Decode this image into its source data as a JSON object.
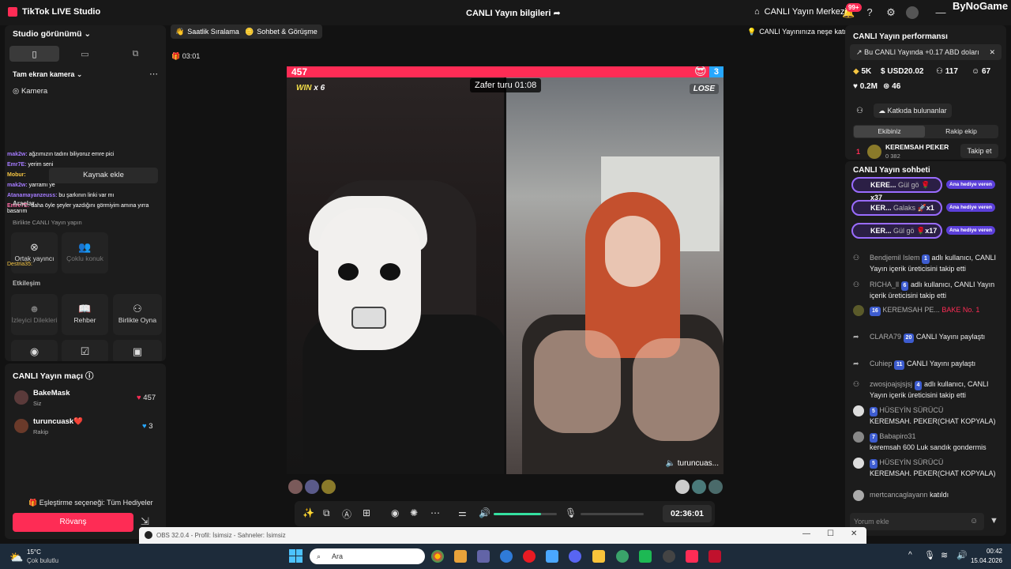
{
  "titlebar": {
    "app_name": "TikTok LIVE Studio",
    "center_title": "CANLI Yayın bilgileri",
    "live_center": "CANLI Yayın Merkezi",
    "notif_badge": "99+",
    "watermark": "ByNoGame"
  },
  "left": {
    "studio_view": "Studio görünümü",
    "fullscreen_camera": "Tam ekran kamera",
    "camera": "Kamera",
    "add_source": "Kaynak ekle",
    "tools_label": "Araçlar",
    "collab_title": "Birlikte CANLI Yayın yapın",
    "co_host": "Ortak yayıncı",
    "multi_guest": "Çoklu konuk",
    "interaction": "Etkileşim",
    "viewer_wishes": "İzleyici Dilekleri",
    "guide": "Rehber",
    "play_together": "Birlikte Oyna",
    "overlay_chat": [
      {
        "user": "mak2w:",
        "text": "ağzımızın tadını biliyoruz emre pici"
      },
      {
        "user": "Emr7E:",
        "text": "yerim seni"
      },
      {
        "user": "Mobur:",
        "text": ""
      },
      {
        "user": "mak2w:",
        "text": "yarramı ye"
      },
      {
        "user": "Atanamayanzeuss:",
        "text": "bu şarkının linki var mı"
      },
      {
        "user": "Emre7E:",
        "text": "daha öyle şeyler yazdığını görmiyim amına yırra basarım"
      },
      {
        "user": "Destria35:",
        "text": ""
      }
    ]
  },
  "match": {
    "title": "CANLI Yayın maçı",
    "players": [
      {
        "name": "BakeMask",
        "role": "Siz",
        "score": "457"
      },
      {
        "name": "turuncuask❤️",
        "role": "Rakip",
        "score": "3"
      }
    ],
    "pairing_option": "Eşleştirme seçeneği: Tüm Hediyeler",
    "rematch": "Rövanş"
  },
  "center": {
    "chips": [
      "Saatlik Sıralama",
      "Sohbet & Görüşme"
    ],
    "right_chip": "CANLI Yayınınıza neşe katın",
    "elapsed_small": "03:01",
    "score_left": "457",
    "score_right": "3",
    "win_label": "WIN",
    "win_count": "x 6",
    "lose_label": "LOSE",
    "round_timer": "Zafer turu 01:08",
    "right_name": "turuncuas...",
    "stream_time": "02:36:01"
  },
  "perf": {
    "title": "CANLI Yayın performansı",
    "banner": "Bu CANLI Yayında +0.17 ABD doları",
    "stats": [
      "5K",
      "USD20.02",
      "117",
      "67",
      "0.2M",
      "46"
    ],
    "contributors": "Katkıda bulunanlar",
    "tab_ours": "Ekibiniz",
    "tab_rival": "Rakip ekip",
    "rank1_num": "1",
    "rank1_name": "KEREMSAH PEKER",
    "rank1_sub": "0  382",
    "follow": "Takip et"
  },
  "chat": {
    "title": "CANLI Yayın sohbeti",
    "gifts": [
      {
        "user": "KERE...",
        "gift": "Gül gö",
        "count": "x37",
        "tag": "Ana hediye veren"
      },
      {
        "user": "KER...",
        "gift": "Galaks",
        "count": "x1",
        "tag": "Ana hediye veren"
      },
      {
        "user": "KER...",
        "gift": "Gül gö",
        "count": "x17",
        "tag": "Ana hediye veren"
      }
    ],
    "messages": [
      {
        "user": "Bendjemil Islem",
        "lvl": "1",
        "text": "adlı kullanıcı, CANLI Yayın içerik üreticisini takip etti"
      },
      {
        "user": "RICHA_ll",
        "lvl": "6",
        "text": "adlı kullanıcı, CANLI Yayın içerik üreticisini takip etti"
      },
      {
        "user": "KEREMSAH PE...",
        "lvl": "16",
        "text": "BAKE  No. 1"
      },
      {
        "user": "CLARA79",
        "lvl": "20",
        "text": "CANLI Yayını paylaştı"
      },
      {
        "user": "Cuhiep",
        "lvl": "11",
        "text": "CANLI Yayını paylaştı"
      },
      {
        "user": "zwosjoajsjsjsj",
        "lvl": "4",
        "text": "adlı kullanıcı, CANLI Yayın içerik üreticisini takip etti"
      },
      {
        "user": "HÜSEYİN SÜRÜCÜ",
        "lvl": "5",
        "text": "KEREMSAH. PEKER(CHAT KOPYALA)"
      },
      {
        "user": "Babapiro31",
        "lvl": "7",
        "text": "keremsah 600 Luk sandık gondermis"
      },
      {
        "user": "HÜSEYİN SÜRÜCÜ",
        "lvl": "5",
        "text": "KEREMSAH. PEKER(CHAT KOPYALA)"
      },
      {
        "user": "mertcancaglayann",
        "lvl": "",
        "text": "katıldı"
      }
    ],
    "placeholder": "Yorum ekle"
  },
  "obs": {
    "title": "OBS 32.0.4 - Profil: İsimsiz - Sahneler: İsimsiz"
  },
  "taskbar": {
    "temp": "15°C",
    "weather": "Çok bulutlu",
    "search": "Ara",
    "time": "00:42",
    "date": "15.04.2026"
  }
}
